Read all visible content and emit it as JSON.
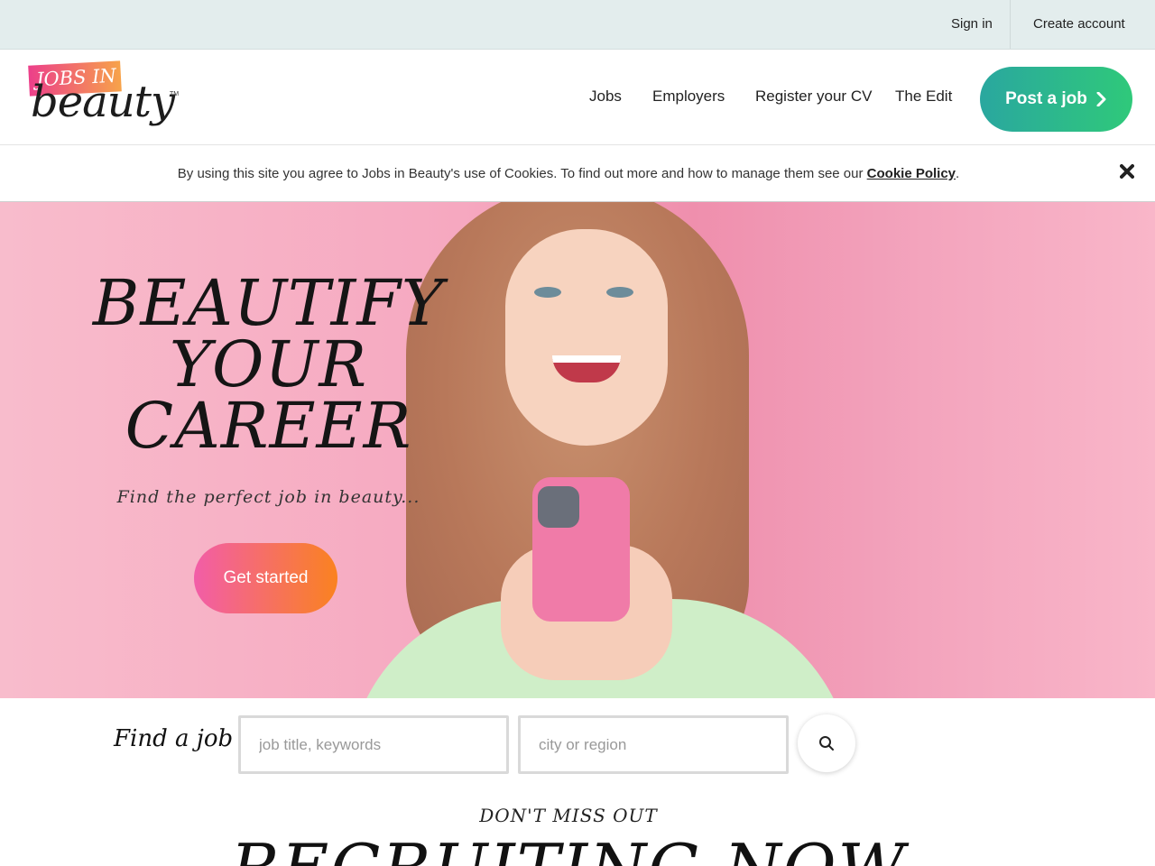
{
  "topbar": {
    "sign_in": "Sign in",
    "create_account": "Create account"
  },
  "logo": {
    "jobs_in": "JOBS IN",
    "beauty": "beauty",
    "tm": "TM"
  },
  "nav": {
    "items": [
      "Jobs",
      "Employers",
      "Register your CV",
      "The Edit"
    ],
    "post_job": "Post a job"
  },
  "cookie": {
    "text": "By using this site you agree to Jobs in Beauty's use of Cookies. To find out more and how to manage them see our ",
    "link": "Cookie Policy",
    "end": "."
  },
  "hero": {
    "headline_lines": [
      "BEAUTIFY",
      "YOUR",
      "CAREER"
    ],
    "subtitle": "Find the perfect job in beauty...",
    "cta": "Get started"
  },
  "search": {
    "label": "Find a job",
    "keywords_placeholder": "job title, keywords",
    "location_placeholder": "city or region",
    "keywords_value": "",
    "location_value": ""
  },
  "section": {
    "eyebrow": "DON'T MISS OUT",
    "title": "RECRUITING NOW"
  },
  "colors": {
    "post_job_start": "#2aa79f",
    "post_job_end": "#2fc97a",
    "cta_start": "#f25da8",
    "cta_end": "#fa8220",
    "hero_bg": "#f6a8c0"
  }
}
